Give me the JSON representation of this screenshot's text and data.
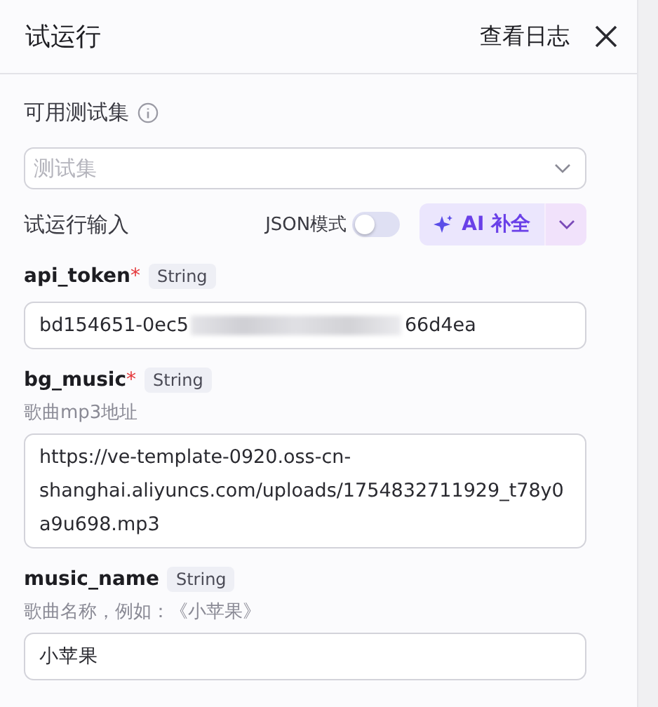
{
  "header": {
    "title": "试运行",
    "log_link": "查看日志"
  },
  "test_set": {
    "label": "可用测试集",
    "placeholder": "测试集"
  },
  "run_input": {
    "label": "试运行输入",
    "json_mode_label": "JSON模式",
    "json_mode_on": false,
    "ai_button": "AI 补全"
  },
  "fields": [
    {
      "name": "api_token",
      "required_mark": "*",
      "type": "String",
      "kind": "redacted",
      "value_start": "bd154651-0ec5",
      "value_end": "66d4ea"
    },
    {
      "name": "bg_music",
      "required_mark": "*",
      "type": "String",
      "description": "歌曲mp3地址",
      "kind": "text",
      "value": "https://ve-template-0920.oss-cn-shanghai.aliyuncs.com/uploads/1754832711929_t78y0a9u698.mp3"
    },
    {
      "name": "music_name",
      "type": "String",
      "description": "歌曲名称，例如：《小苹果》",
      "kind": "text",
      "value": "小苹果"
    }
  ]
}
